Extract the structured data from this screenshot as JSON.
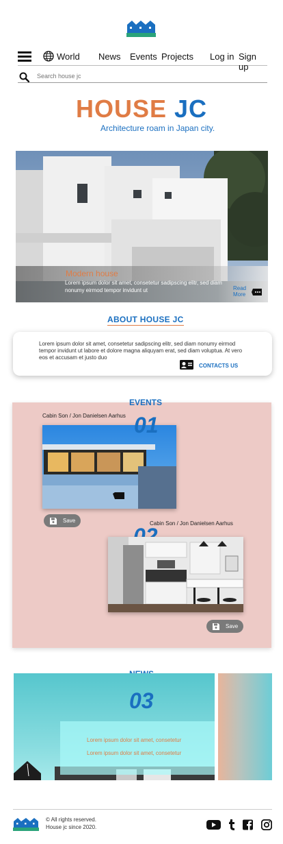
{
  "header": {
    "logo": "house-jc-logo",
    "nav": {
      "menu_icon": "hamburger-icon",
      "world_icon": "globe-icon",
      "world": "World",
      "news": "News",
      "events": "Events",
      "projects": "Projects",
      "login": "Log in",
      "signup": "Sign up"
    },
    "search": {
      "placeholder": "Search house jc",
      "icon": "search-icon"
    }
  },
  "brand": {
    "part1": "HOUSE",
    "part2": "JC",
    "tagline": "Architecture roam in  Japan city."
  },
  "hero": {
    "title": "Modern house",
    "body": "Lorem ipsum dolor sit amet, consetetur sadipscing elitr, sed diam nonumy eirmod tempor invidunt ut",
    "read_more_1": "Read",
    "read_more_2": "More",
    "icon": "chat-bubble-icon"
  },
  "about": {
    "title": "ABOUT HOUSE JC",
    "text": "Lorem ipsum dolor sit amet, consetetur sadipscing elitr, sed diam nonumy eirmod tempor invidunt ut labore et dolore magna aliquyam erat, sed diam voluptua. At vero eos et accusam et justo duo",
    "contact_label": "CONTACTS US",
    "contact_icon": "contact-card-icon"
  },
  "events": {
    "title": "EVENTS",
    "items": [
      {
        "caption": "Cabin Son / Jon Danielsen Aarhus",
        "number": "01",
        "save": "Save"
      },
      {
        "caption": "Cabin Son / Jon Danielsen Aarhus",
        "number": "02",
        "save": "Save"
      }
    ]
  },
  "news": {
    "title": "NEWS",
    "number": "03",
    "line1": "Lorem ipsum dolor sit amet, consetetur",
    "line2": "Lorem ipsum dolor sit amet, consetetur"
  },
  "footer": {
    "copyright": "© All rights reserved.",
    "since": "House jc since 2020.",
    "social": [
      "youtube-icon",
      "tumblr-icon",
      "facebook-icon",
      "instagram-icon"
    ]
  },
  "colors": {
    "accent_orange": "#e07c45",
    "accent_blue": "#1a6fc0",
    "events_bg": "#edcac6"
  }
}
